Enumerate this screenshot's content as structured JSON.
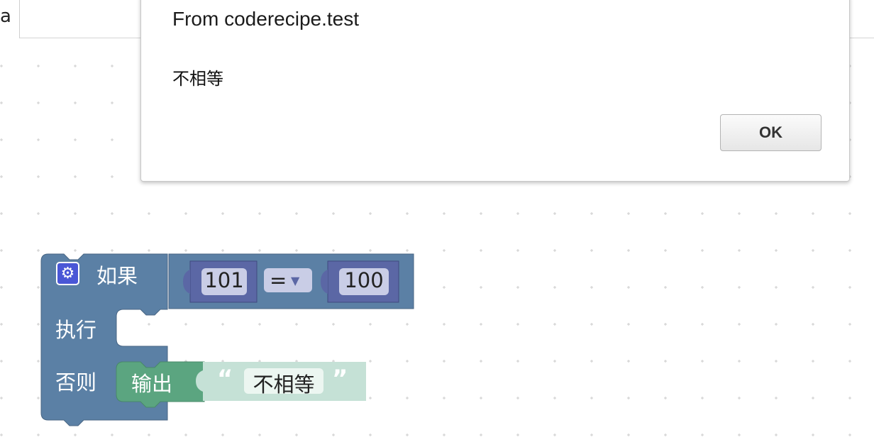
{
  "browser": {
    "tab_stub_text": "a"
  },
  "dialog": {
    "title": "From coderecipe.test",
    "message": "不相等",
    "ok_label": "OK"
  },
  "blocks": {
    "if_block": {
      "if_label": "如果",
      "do_label": "执行",
      "else_label": "否则",
      "gear_icon": "gear-icon",
      "color": "#5b80a5"
    },
    "compare_block": {
      "left_value": "101",
      "operator": "=",
      "right_value": "100",
      "color": "#5b67a5"
    },
    "print_block": {
      "label": "输出",
      "color": "#5ba580"
    },
    "text_block": {
      "open_quote": "“",
      "value": "不相等",
      "close_quote": "”",
      "color": "#c5e1d6"
    }
  }
}
